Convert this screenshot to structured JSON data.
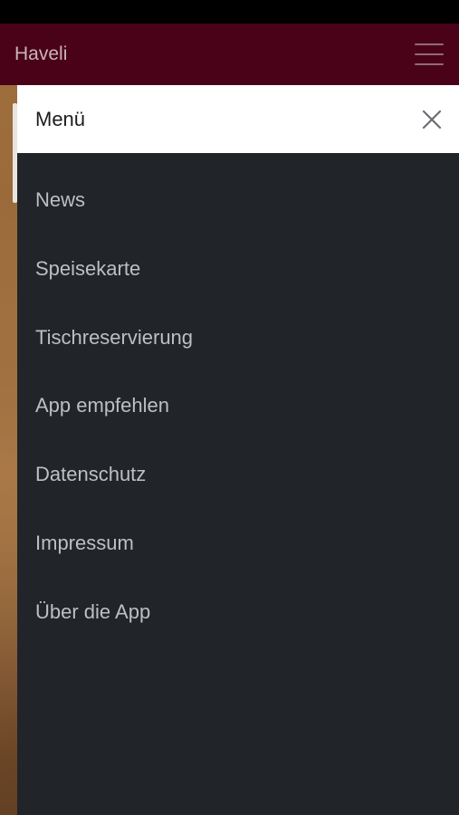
{
  "app_bar": {
    "title": "Haveli",
    "menu_icon": "hamburger-icon",
    "background": "#4a0219"
  },
  "drawer": {
    "title": "Menü",
    "close_icon": "close-icon",
    "background": "#212529",
    "items": [
      {
        "label": "News"
      },
      {
        "label": "Speisekarte"
      },
      {
        "label": "Tischreservierung"
      },
      {
        "label": "App empfehlen"
      },
      {
        "label": "Datenschutz"
      },
      {
        "label": "Impressum"
      },
      {
        "label": "Über die App"
      }
    ]
  }
}
